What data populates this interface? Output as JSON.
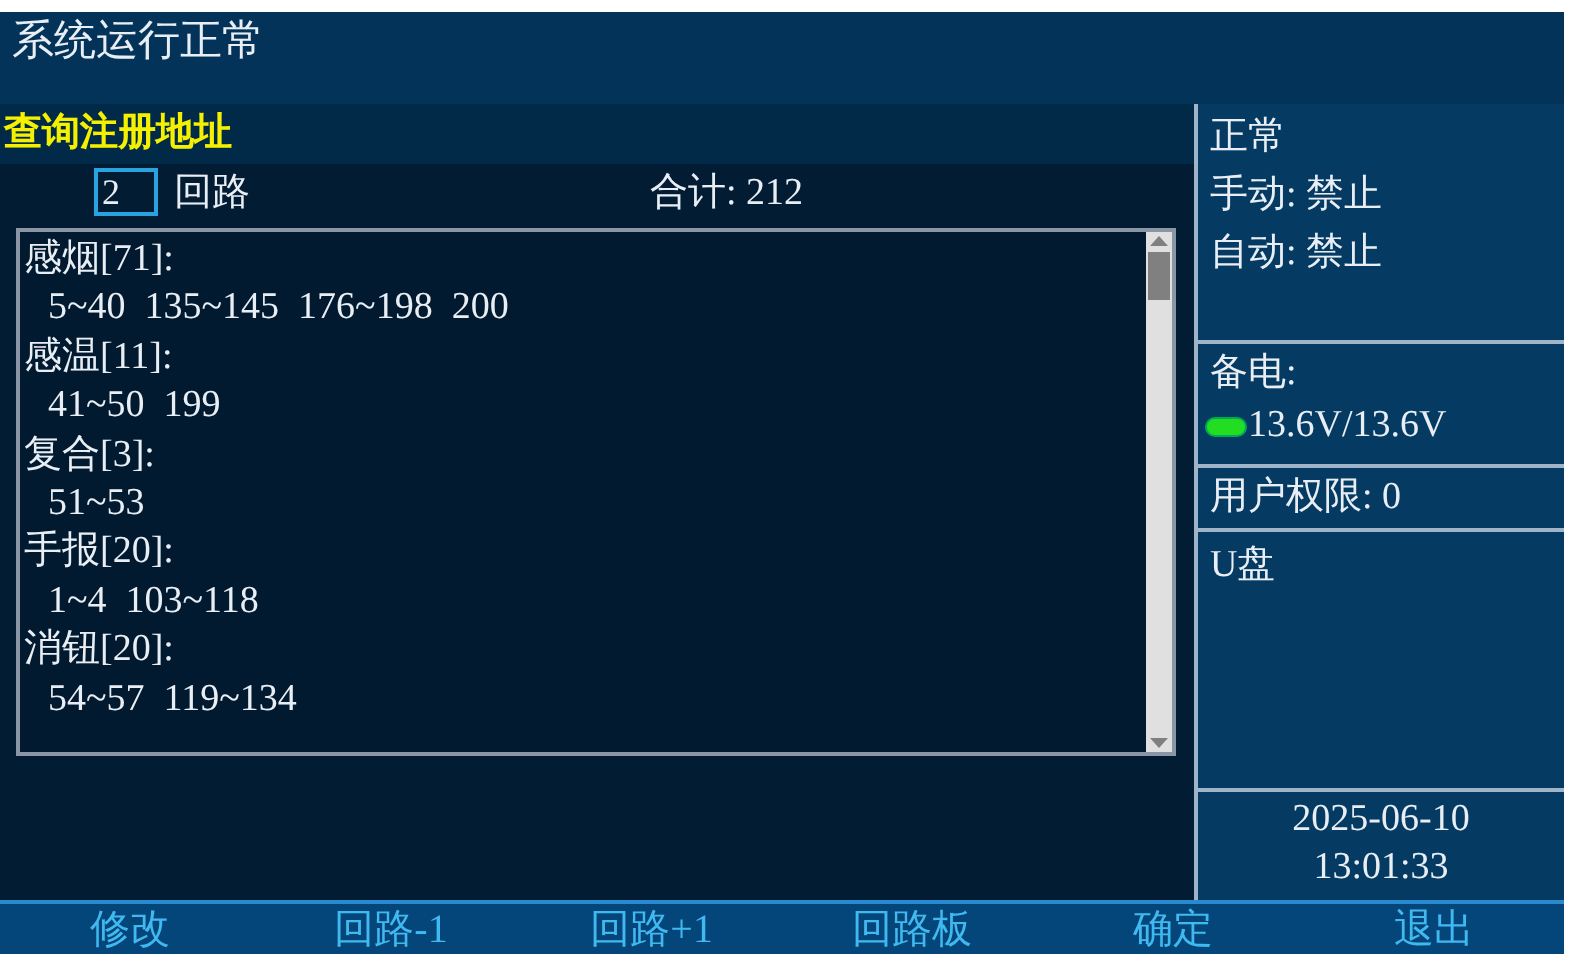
{
  "title_bar": {
    "title": "系统运行正常"
  },
  "page": {
    "title": "查询注册地址",
    "loop_field": {
      "value": "2"
    },
    "loop_label": "回路",
    "total": "合计: 212"
  },
  "registry": [
    {
      "heading": "感烟[71]:",
      "ranges": "5~40  135~145  176~198  200"
    },
    {
      "heading": "感温[11]:",
      "ranges": "41~50  199"
    },
    {
      "heading": "复合[3]:",
      "ranges": "51~53"
    },
    {
      "heading": "手报[20]:",
      "ranges": "1~4  103~118"
    },
    {
      "heading": "消钮[20]:",
      "ranges": "54~57  119~134"
    }
  ],
  "status_panel": {
    "state": "正常",
    "manual": "手动: 禁止",
    "auto": "自动: 禁止",
    "backup_power_label": "备电:",
    "backup_power": "13.6V/13.6V",
    "user_level": "用户权限: 0",
    "usb": "U盘",
    "date": "2025-06-10",
    "time": "13:01:33"
  },
  "softkeys": [
    "修改",
    "回路-1",
    "回路+1",
    "回路板",
    "确定",
    "退出"
  ]
}
